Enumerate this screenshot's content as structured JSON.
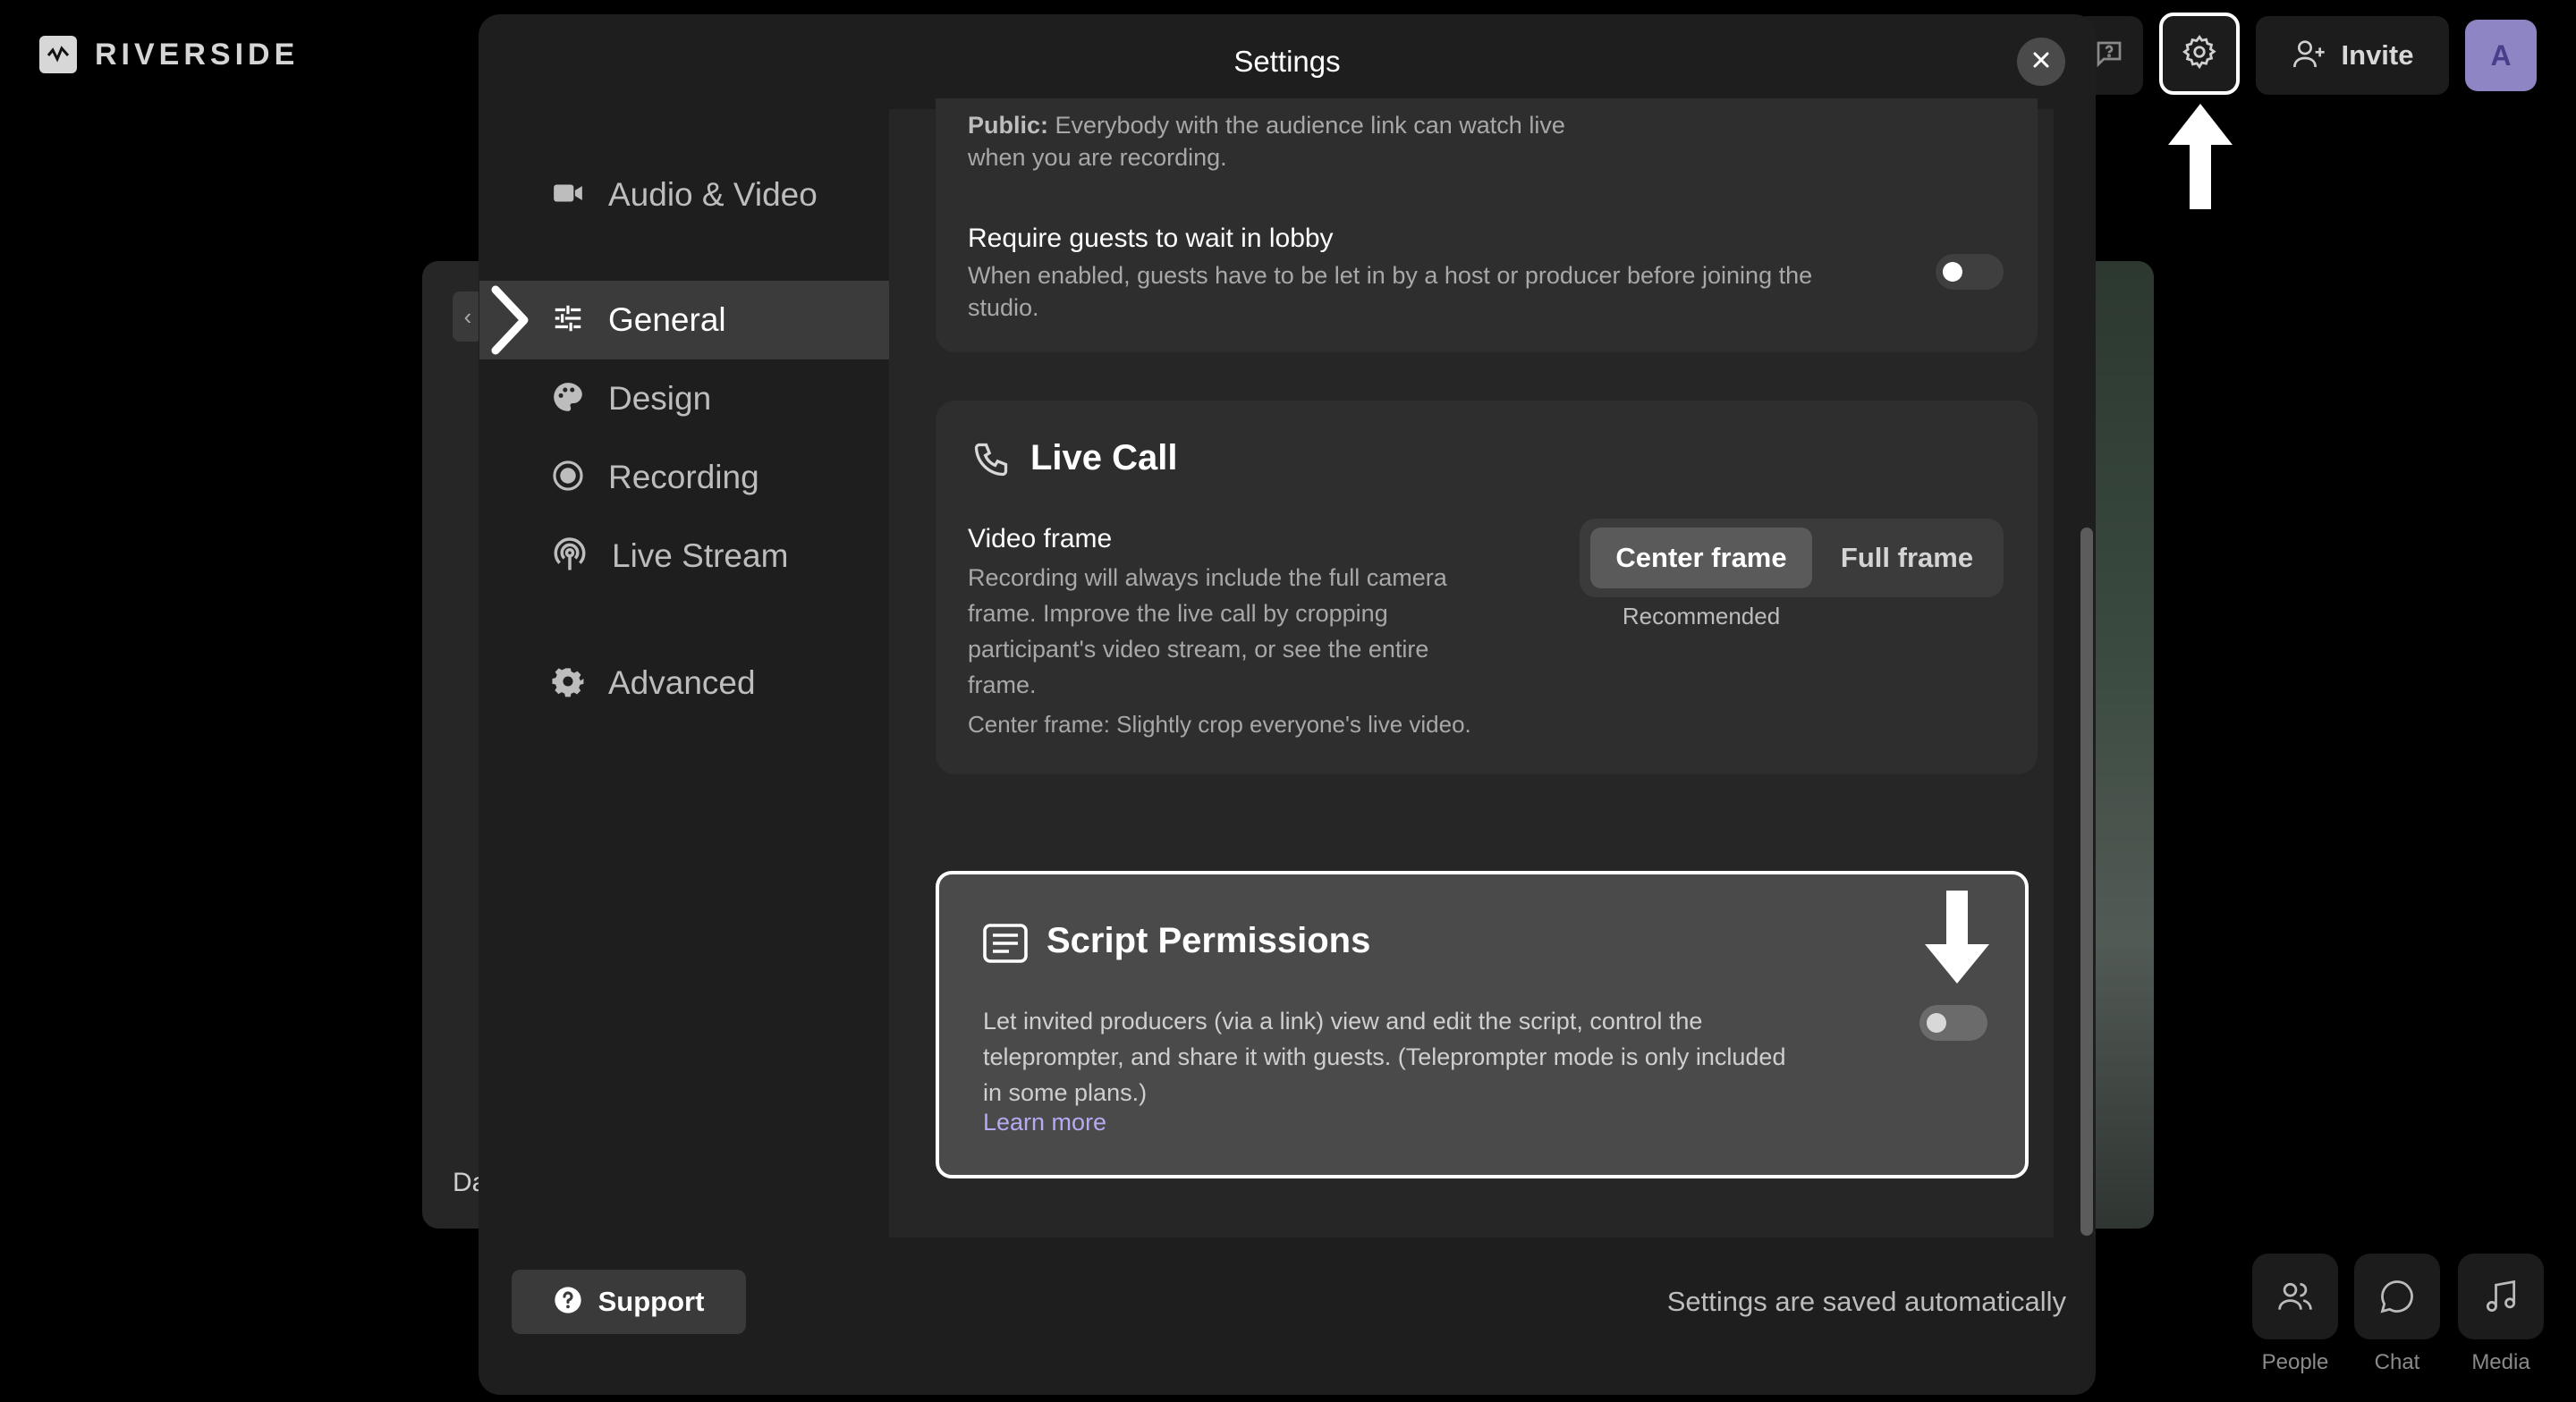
{
  "app": {
    "logo_text": "RIVERSIDE"
  },
  "topbar": {
    "invite_label": "Invite",
    "avatar_initial": "A"
  },
  "stage": {
    "participant_name": "Da"
  },
  "bottom_controls": {
    "people": "People",
    "chat": "Chat",
    "media": "Media"
  },
  "settings": {
    "title": "Settings",
    "nav": [
      {
        "label": "Audio & Video",
        "icon": "video-camera-icon"
      },
      {
        "label": "General",
        "icon": "sliders-icon",
        "active": true
      },
      {
        "label": "Design",
        "icon": "palette-icon"
      },
      {
        "label": "Recording",
        "icon": "record-icon"
      },
      {
        "label": "Live Stream",
        "icon": "broadcast-icon"
      },
      {
        "label": "Advanced",
        "icon": "gear-icon"
      }
    ],
    "audience": {
      "public_label": "Public:",
      "public_desc_line1": "Everybody with the audience link can watch live",
      "public_desc_line2": "when you are recording."
    },
    "lobby": {
      "title": "Require guests to wait in lobby",
      "desc_line1": "When enabled, guests have to be let in by a host or producer before joining the",
      "desc_line2": "studio.",
      "enabled": false
    },
    "live_call": {
      "title": "Live Call",
      "video_frame_title": "Video frame",
      "desc_lines": [
        "Recording will always include the full camera",
        "frame. Improve the live call by cropping",
        "participant's video stream, or see the entire",
        "frame."
      ],
      "note": "Center frame: Slightly crop everyone's live video.",
      "options": {
        "center": "Center frame",
        "full": "Full frame"
      },
      "selected": "Center frame",
      "recommended": "Recommended"
    },
    "script_permissions": {
      "title": "Script Permissions",
      "desc_lines": [
        "Let invited producers (via a link) view and edit the script, control the",
        "teleprompter, and share it with guests. (Teleprompter mode is only included",
        "in some plans.)"
      ],
      "learn_more": "Learn more",
      "enabled": false
    },
    "support_label": "Support",
    "saved_text": "Settings are saved automatically"
  },
  "colors": {
    "accent_link": "#b7a9f3",
    "avatar_bg": "#8e86c4"
  }
}
